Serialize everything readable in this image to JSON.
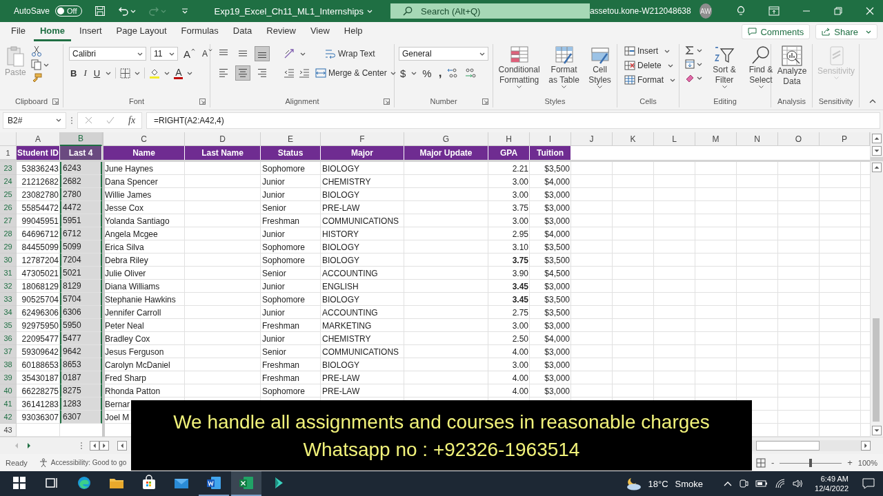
{
  "title_bar": {
    "autosave_label": "AutoSave",
    "autosave": {
      "on": false,
      "label": "Off"
    },
    "file_name": "Exp19_Excel_Ch11_ML1_Internships",
    "search_placeholder": "Search (Alt+Q)",
    "user": "assetou.kone-W212048638",
    "avatar": "AW"
  },
  "menu_tabs": [
    {
      "label": "File",
      "selected": false
    },
    {
      "label": "Home",
      "selected": true
    },
    {
      "label": "Insert",
      "selected": false
    },
    {
      "label": "Page Layout",
      "selected": false
    },
    {
      "label": "Formulas",
      "selected": false
    },
    {
      "label": "Data",
      "selected": false
    },
    {
      "label": "Review",
      "selected": false
    },
    {
      "label": "View",
      "selected": false
    },
    {
      "label": "Help",
      "selected": false
    }
  ],
  "comments": "Comments",
  "share": "Share",
  "ribbon": {
    "clipboard": {
      "paste": "Paste",
      "label": "Clipboard"
    },
    "font": {
      "name": "Calibri",
      "size": "11",
      "grow": "A",
      "shrink": "A",
      "bold": "B",
      "italic": "I",
      "underline": "U",
      "font_color": "A",
      "label": "Font"
    },
    "alignment": {
      "buttons": [
        {
          "kind": "top",
          "selected": false
        },
        {
          "kind": "middle",
          "selected": false
        },
        {
          "kind": "bottom",
          "selected": true
        },
        {
          "kind": "left",
          "selected": false
        },
        {
          "kind": "center",
          "selected": true
        },
        {
          "kind": "right",
          "selected": false
        }
      ],
      "wrap_text": "Wrap Text",
      "merge": "Merge & Center",
      "label": "Alignment"
    },
    "number": {
      "format": "General",
      "currency": "$",
      "percent": "%",
      "comma": ",",
      "label": "Number"
    },
    "styles": {
      "buttons": [
        {
          "label": "Conditional Formatting"
        },
        {
          "label": "Format as Table"
        },
        {
          "label": "Cell Styles"
        }
      ],
      "label": "Styles"
    },
    "cells": {
      "buttons": [
        "Insert",
        "Delete",
        "Format"
      ],
      "label": "Cells"
    },
    "editing": {
      "sort": "Sort & Filter",
      "find": "Find & Select",
      "label": "Editing"
    },
    "analysis": {
      "button": "Analyze Data",
      "label": "Analysis"
    },
    "sensitivity": {
      "button": "Sensitivity",
      "disabled": true,
      "label": "Sensitivity"
    }
  },
  "formula_bar": {
    "name_box": "B2#",
    "fx": "fx",
    "formula": "=RIGHT(A2:A42,4)"
  },
  "sheet": {
    "columns": [
      {
        "letter": "A",
        "selected": false
      },
      {
        "letter": "B",
        "selected": true
      },
      {
        "letter": "C",
        "selected": false
      },
      {
        "letter": "D",
        "selected": false
      },
      {
        "letter": "E",
        "selected": false
      },
      {
        "letter": "F",
        "selected": false
      },
      {
        "letter": "G",
        "selected": false
      },
      {
        "letter": "H",
        "selected": false
      },
      {
        "letter": "I",
        "selected": false
      },
      {
        "letter": "J",
        "selected": false
      },
      {
        "letter": "K",
        "selected": false
      },
      {
        "letter": "L",
        "selected": false
      },
      {
        "letter": "M",
        "selected": false
      },
      {
        "letter": "N",
        "selected": false
      },
      {
        "letter": "O",
        "selected": false
      },
      {
        "letter": "P",
        "selected": false
      }
    ],
    "header_row": {
      "number": "1",
      "cells": [
        "Student ID",
        "Last 4",
        "Name",
        "Last Name",
        "Status",
        "Major",
        "Major Update",
        "GPA",
        "Tuition"
      ]
    },
    "rows": [
      {
        "number": "23",
        "selected": true,
        "student_id": "53836243",
        "last4": "6243",
        "name": "June Haynes",
        "status": "Sophomore",
        "major": "BIOLOGY",
        "gpa": "2.21",
        "gpa_bold": false,
        "tuition": "$3,500"
      },
      {
        "number": "24",
        "selected": true,
        "student_id": "21212682",
        "last4": "2682",
        "name": "Dana Spencer",
        "status": "Junior",
        "major": "CHEMISTRY",
        "gpa": "3.00",
        "gpa_bold": false,
        "tuition": "$4,000"
      },
      {
        "number": "25",
        "selected": true,
        "student_id": "23082780",
        "last4": "2780",
        "name": "Willie James",
        "status": "Junior",
        "major": "BIOLOGY",
        "gpa": "3.00",
        "gpa_bold": false,
        "tuition": "$3,000"
      },
      {
        "number": "26",
        "selected": true,
        "student_id": "55854472",
        "last4": "4472",
        "name": "Jesse Cox",
        "status": "Senior",
        "major": "PRE-LAW",
        "gpa": "3.75",
        "gpa_bold": false,
        "tuition": "$3,000"
      },
      {
        "number": "27",
        "selected": true,
        "student_id": "99045951",
        "last4": "5951",
        "name": "Yolanda Santiago",
        "status": "Freshman",
        "major": "COMMUNICATIONS",
        "gpa": "3.00",
        "gpa_bold": false,
        "tuition": "$3,000"
      },
      {
        "number": "28",
        "selected": true,
        "student_id": "64696712",
        "last4": "6712",
        "name": "Angela Mcgee",
        "status": "Junior",
        "major": "HISTORY",
        "gpa": "2.95",
        "gpa_bold": false,
        "tuition": "$4,000"
      },
      {
        "number": "29",
        "selected": true,
        "student_id": "84455099",
        "last4": "5099",
        "name": "Erica Silva",
        "status": "Sophomore",
        "major": "BIOLOGY",
        "gpa": "3.10",
        "gpa_bold": false,
        "tuition": "$3,500"
      },
      {
        "number": "30",
        "selected": true,
        "student_id": "12787204",
        "last4": "7204",
        "name": "Debra Riley",
        "status": "Sophomore",
        "major": "BIOLOGY",
        "gpa": "3.75",
        "gpa_bold": true,
        "tuition": "$3,500"
      },
      {
        "number": "31",
        "selected": true,
        "student_id": "47305021",
        "last4": "5021",
        "name": "Julie Oliver",
        "status": "Senior",
        "major": "ACCOUNTING",
        "gpa": "3.90",
        "gpa_bold": false,
        "tuition": "$4,500"
      },
      {
        "number": "32",
        "selected": true,
        "student_id": "18068129",
        "last4": "8129",
        "name": "Diana Williams",
        "status": "Junior",
        "major": "ENGLISH",
        "gpa": "3.45",
        "gpa_bold": true,
        "tuition": "$3,000"
      },
      {
        "number": "33",
        "selected": true,
        "student_id": "90525704",
        "last4": "5704",
        "name": "Stephanie Hawkins",
        "status": "Sophomore",
        "major": "BIOLOGY",
        "gpa": "3.45",
        "gpa_bold": true,
        "tuition": "$3,500"
      },
      {
        "number": "34",
        "selected": true,
        "student_id": "62496306",
        "last4": "6306",
        "name": "Jennifer Carroll",
        "status": "Junior",
        "major": "ACCOUNTING",
        "gpa": "2.75",
        "gpa_bold": false,
        "tuition": "$3,500"
      },
      {
        "number": "35",
        "selected": true,
        "student_id": "92975950",
        "last4": "5950",
        "name": "Peter Neal",
        "status": "Freshman",
        "major": "MARKETING",
        "gpa": "3.00",
        "gpa_bold": false,
        "tuition": "$3,000"
      },
      {
        "number": "36",
        "selected": true,
        "student_id": "22095477",
        "last4": "5477",
        "name": "Bradley Cox",
        "status": "Junior",
        "major": "CHEMISTRY",
        "gpa": "2.50",
        "gpa_bold": false,
        "tuition": "$4,000"
      },
      {
        "number": "37",
        "selected": true,
        "student_id": "59309642",
        "last4": "9642",
        "name": "Jesus Ferguson",
        "status": "Senior",
        "major": "COMMUNICATIONS",
        "gpa": "4.00",
        "gpa_bold": false,
        "tuition": "$3,000"
      },
      {
        "number": "38",
        "selected": true,
        "student_id": "60188653",
        "last4": "8653",
        "name": "Carolyn McDaniel",
        "status": "Freshman",
        "major": "BIOLOGY",
        "gpa": "3.00",
        "gpa_bold": false,
        "tuition": "$3,000"
      },
      {
        "number": "39",
        "selected": true,
        "student_id": "35430187",
        "last4": "0187",
        "name": "Fred Sharp",
        "status": "Freshman",
        "major": "PRE-LAW",
        "gpa": "4.00",
        "gpa_bold": false,
        "tuition": "$3,000"
      },
      {
        "number": "40",
        "selected": true,
        "student_id": "66228275",
        "last4": "8275",
        "name": "Rhonda Patton",
        "status": "Sophomore",
        "major": "PRE-LAW",
        "gpa": "4.00",
        "gpa_bold": false,
        "tuition": "$3,000"
      },
      {
        "number": "41",
        "selected": true,
        "student_id": "36141283",
        "last4": "1283",
        "name": "Bernar"
      },
      {
        "number": "42",
        "selected": true,
        "student_id": "93036307",
        "last4": "6307",
        "name": "Joel M"
      },
      {
        "number": "43",
        "selected": false
      }
    ]
  },
  "status_bar": {
    "ready": "Ready",
    "accessibility": "Accessibility: Good to go",
    "zoom": {
      "minus": "-",
      "plus": "+",
      "level": 0.5,
      "label": "100%"
    }
  },
  "taskbar": {
    "apps": [
      {
        "kind": "start",
        "running": false,
        "selected": false
      },
      {
        "kind": "taskview",
        "running": false,
        "selected": false
      },
      {
        "kind": "edge",
        "running": false,
        "selected": false
      },
      {
        "kind": "explorer",
        "running": false,
        "selected": false
      },
      {
        "kind": "store",
        "running": false,
        "selected": false
      },
      {
        "kind": "mail",
        "running": false,
        "selected": false
      },
      {
        "kind": "word",
        "running": true,
        "selected": false
      },
      {
        "kind": "excel",
        "running": true,
        "selected": true
      },
      {
        "kind": "other",
        "running": false,
        "selected": false
      }
    ],
    "weather": {
      "temp": "18°C",
      "condition": "Smoke"
    },
    "time": "6:49 AM",
    "date": "12/4/2022"
  },
  "caption_overlay": {
    "lines": [
      "We handle all assignments and courses in reasonable charges",
      "Whatsapp no : +92326-1963514"
    ]
  }
}
